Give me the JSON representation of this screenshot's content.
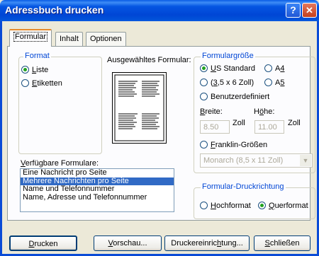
{
  "window": {
    "title": "Adressbuch drucken"
  },
  "titlebar_buttons": {
    "help_label": "?",
    "close_label": "✕"
  },
  "tabs": [
    {
      "label": "Formular"
    },
    {
      "label": "Inhalt"
    },
    {
      "label": "Optionen"
    }
  ],
  "format": {
    "label": "Format",
    "options": [
      {
        "pre": "",
        "key": "L",
        "post": "iste",
        "selected": true
      },
      {
        "pre": "",
        "key": "E",
        "post": "tiketten",
        "selected": false
      }
    ]
  },
  "preview_label": "Ausgewähltes Formular:",
  "forms": {
    "label_key": "V",
    "label_post": "erfügbare Formulare:",
    "items": [
      "Eine Nachricht pro Seite",
      "Mehrere Nachrichten pro Seite",
      "Name und Telefonnummer",
      "Name, Adresse und Telefonnummer"
    ],
    "selected_index": 1
  },
  "size": {
    "label": "Formulargröße",
    "us_pre": "",
    "us_key": "U",
    "us_post": "S Standard",
    "a4_pre": "A",
    "a4_key": "4",
    "a4_post": "",
    "small_pre": "(",
    "small_key": "3",
    "small_post": ",5 x 6 Zoll)",
    "a5_pre": "A",
    "a5_key": "5",
    "a5_post": "",
    "custom": "Benutzerdefiniert",
    "width_key": "B",
    "width_post": "reite:",
    "height_pre": "H",
    "height_key": "ö",
    "height_post": "he:",
    "width_value": "8.50",
    "height_value": "11.00",
    "unit": "Zoll",
    "franklin_pre": "",
    "franklin_key": "F",
    "franklin_post": "ranklin-Größen",
    "franklin_value": "Monarch  (8,5 x 11 Zoll)"
  },
  "orientation": {
    "label": "Formular-Druckrichtung",
    "portrait_pre": "",
    "portrait_key": "H",
    "portrait_post": "ochformat",
    "landscape_pre": "",
    "landscape_key": "Q",
    "landscape_post": "uerformat"
  },
  "buttons": [
    {
      "pre": "",
      "key": "D",
      "post": "rucken"
    },
    {
      "pre": "",
      "key": "V",
      "post": "orschau..."
    },
    {
      "pre": "Druckereinric",
      "key": "h",
      "post": "tung..."
    },
    {
      "pre": "",
      "key": "S",
      "post": "chließen"
    }
  ]
}
